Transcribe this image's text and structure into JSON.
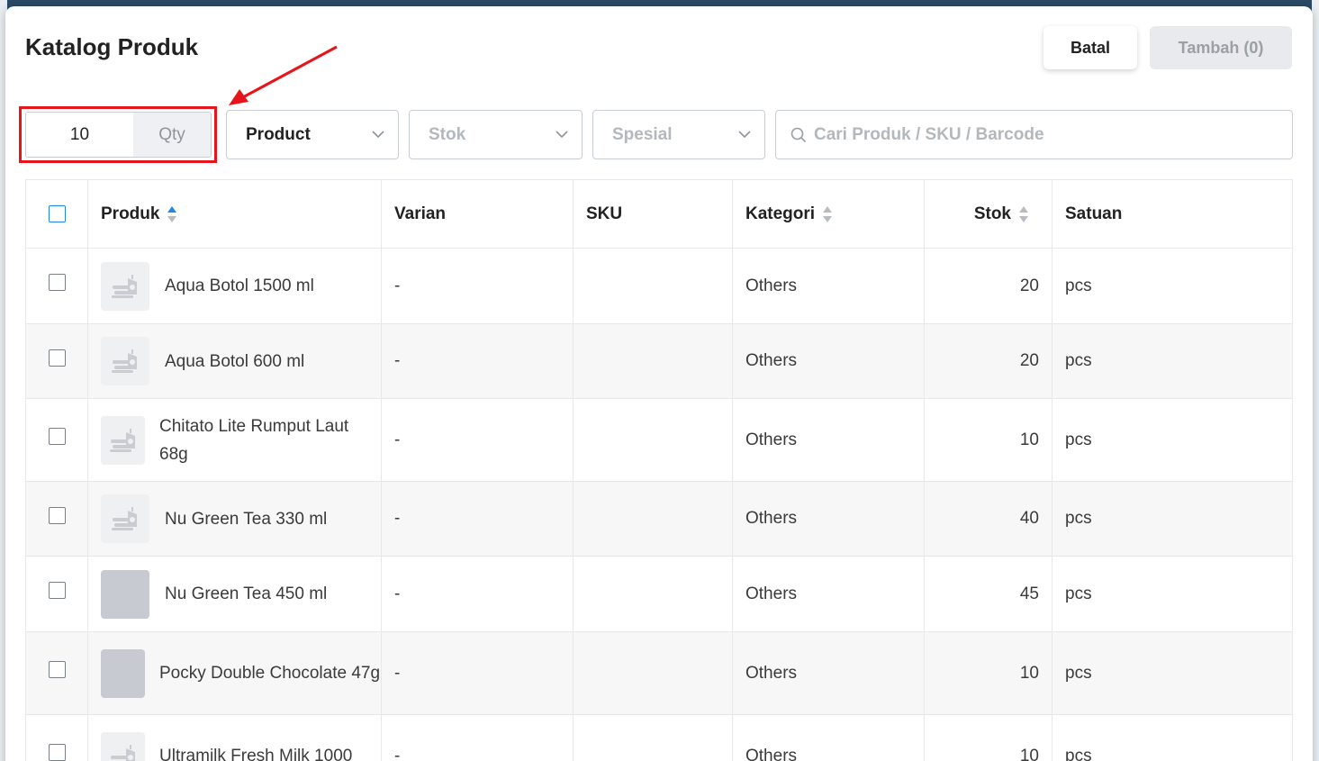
{
  "modal": {
    "title": "Katalog Produk",
    "cancel_label": "Batal",
    "add_label": "Tambah (0)"
  },
  "filters": {
    "qty_value": "10",
    "qty_label": "Qty",
    "product_select": "Product",
    "stok_select": "Stok",
    "spesial_select": "Spesial",
    "search_placeholder": "Cari Produk / SKU / Barcode"
  },
  "table": {
    "headers": {
      "produk": "Produk",
      "varian": "Varian",
      "sku": "SKU",
      "kategori": "Kategori",
      "stok": "Stok",
      "satuan": "Satuan"
    },
    "rows": [
      {
        "name": "Aqua Botol 1500 ml",
        "varian": "-",
        "sku": "",
        "kategori": "Others",
        "stok": "20",
        "satuan": "pcs",
        "thumb": "placeholder-icon"
      },
      {
        "name": "Aqua Botol 600 ml",
        "varian": "-",
        "sku": "",
        "kategori": "Others",
        "stok": "20",
        "satuan": "pcs",
        "thumb": "placeholder-icon"
      },
      {
        "name": "Chitato Lite Rumput Laut 68g",
        "varian": "-",
        "sku": "",
        "kategori": "Others",
        "stok": "10",
        "satuan": "pcs",
        "thumb": "placeholder-icon"
      },
      {
        "name": "Nu Green Tea 330 ml",
        "varian": "-",
        "sku": "",
        "kategori": "Others",
        "stok": "40",
        "satuan": "pcs",
        "thumb": "placeholder-icon"
      },
      {
        "name": "Nu Green Tea 450 ml",
        "varian": "-",
        "sku": "",
        "kategori": "Others",
        "stok": "45",
        "satuan": "pcs",
        "thumb": "plain"
      },
      {
        "name": "Pocky Double Chocolate 47g",
        "varian": "-",
        "sku": "",
        "kategori": "Others",
        "stok": "10",
        "satuan": "pcs",
        "thumb": "plain"
      },
      {
        "name": "Ultramilk Fresh Milk 1000",
        "varian": "-",
        "sku": "",
        "kategori": "Others",
        "stok": "10",
        "satuan": "pcs",
        "thumb": "placeholder-icon"
      }
    ]
  },
  "colors": {
    "annotation": "#e8141b",
    "checkbox_header": "#1e88e5",
    "sort_active": "#1e88e5"
  }
}
